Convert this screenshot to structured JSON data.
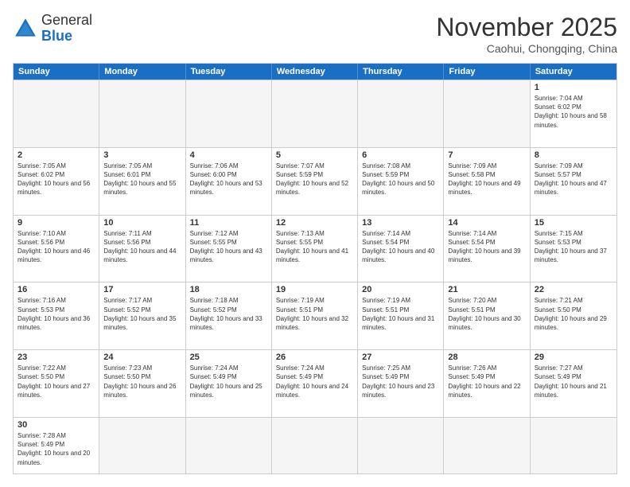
{
  "header": {
    "logo_general": "General",
    "logo_blue": "Blue",
    "month": "November 2025",
    "location": "Caohui, Chongqing, China"
  },
  "weekdays": [
    "Sunday",
    "Monday",
    "Tuesday",
    "Wednesday",
    "Thursday",
    "Friday",
    "Saturday"
  ],
  "weeks": [
    [
      {
        "day": "",
        "info": ""
      },
      {
        "day": "",
        "info": ""
      },
      {
        "day": "",
        "info": ""
      },
      {
        "day": "",
        "info": ""
      },
      {
        "day": "",
        "info": ""
      },
      {
        "day": "",
        "info": ""
      },
      {
        "day": "1",
        "info": "Sunrise: 7:04 AM\nSunset: 6:02 PM\nDaylight: 10 hours and 58 minutes."
      }
    ],
    [
      {
        "day": "2",
        "info": "Sunrise: 7:05 AM\nSunset: 6:02 PM\nDaylight: 10 hours and 56 minutes."
      },
      {
        "day": "3",
        "info": "Sunrise: 7:05 AM\nSunset: 6:01 PM\nDaylight: 10 hours and 55 minutes."
      },
      {
        "day": "4",
        "info": "Sunrise: 7:06 AM\nSunset: 6:00 PM\nDaylight: 10 hours and 53 minutes."
      },
      {
        "day": "5",
        "info": "Sunrise: 7:07 AM\nSunset: 5:59 PM\nDaylight: 10 hours and 52 minutes."
      },
      {
        "day": "6",
        "info": "Sunrise: 7:08 AM\nSunset: 5:59 PM\nDaylight: 10 hours and 50 minutes."
      },
      {
        "day": "7",
        "info": "Sunrise: 7:09 AM\nSunset: 5:58 PM\nDaylight: 10 hours and 49 minutes."
      },
      {
        "day": "8",
        "info": "Sunrise: 7:09 AM\nSunset: 5:57 PM\nDaylight: 10 hours and 47 minutes."
      }
    ],
    [
      {
        "day": "9",
        "info": "Sunrise: 7:10 AM\nSunset: 5:56 PM\nDaylight: 10 hours and 46 minutes."
      },
      {
        "day": "10",
        "info": "Sunrise: 7:11 AM\nSunset: 5:56 PM\nDaylight: 10 hours and 44 minutes."
      },
      {
        "day": "11",
        "info": "Sunrise: 7:12 AM\nSunset: 5:55 PM\nDaylight: 10 hours and 43 minutes."
      },
      {
        "day": "12",
        "info": "Sunrise: 7:13 AM\nSunset: 5:55 PM\nDaylight: 10 hours and 41 minutes."
      },
      {
        "day": "13",
        "info": "Sunrise: 7:14 AM\nSunset: 5:54 PM\nDaylight: 10 hours and 40 minutes."
      },
      {
        "day": "14",
        "info": "Sunrise: 7:14 AM\nSunset: 5:54 PM\nDaylight: 10 hours and 39 minutes."
      },
      {
        "day": "15",
        "info": "Sunrise: 7:15 AM\nSunset: 5:53 PM\nDaylight: 10 hours and 37 minutes."
      }
    ],
    [
      {
        "day": "16",
        "info": "Sunrise: 7:16 AM\nSunset: 5:53 PM\nDaylight: 10 hours and 36 minutes."
      },
      {
        "day": "17",
        "info": "Sunrise: 7:17 AM\nSunset: 5:52 PM\nDaylight: 10 hours and 35 minutes."
      },
      {
        "day": "18",
        "info": "Sunrise: 7:18 AM\nSunset: 5:52 PM\nDaylight: 10 hours and 33 minutes."
      },
      {
        "day": "19",
        "info": "Sunrise: 7:19 AM\nSunset: 5:51 PM\nDaylight: 10 hours and 32 minutes."
      },
      {
        "day": "20",
        "info": "Sunrise: 7:19 AM\nSunset: 5:51 PM\nDaylight: 10 hours and 31 minutes."
      },
      {
        "day": "21",
        "info": "Sunrise: 7:20 AM\nSunset: 5:51 PM\nDaylight: 10 hours and 30 minutes."
      },
      {
        "day": "22",
        "info": "Sunrise: 7:21 AM\nSunset: 5:50 PM\nDaylight: 10 hours and 29 minutes."
      }
    ],
    [
      {
        "day": "23",
        "info": "Sunrise: 7:22 AM\nSunset: 5:50 PM\nDaylight: 10 hours and 27 minutes."
      },
      {
        "day": "24",
        "info": "Sunrise: 7:23 AM\nSunset: 5:50 PM\nDaylight: 10 hours and 26 minutes."
      },
      {
        "day": "25",
        "info": "Sunrise: 7:24 AM\nSunset: 5:49 PM\nDaylight: 10 hours and 25 minutes."
      },
      {
        "day": "26",
        "info": "Sunrise: 7:24 AM\nSunset: 5:49 PM\nDaylight: 10 hours and 24 minutes."
      },
      {
        "day": "27",
        "info": "Sunrise: 7:25 AM\nSunset: 5:49 PM\nDaylight: 10 hours and 23 minutes."
      },
      {
        "day": "28",
        "info": "Sunrise: 7:26 AM\nSunset: 5:49 PM\nDaylight: 10 hours and 22 minutes."
      },
      {
        "day": "29",
        "info": "Sunrise: 7:27 AM\nSunset: 5:49 PM\nDaylight: 10 hours and 21 minutes."
      }
    ],
    [
      {
        "day": "30",
        "info": "Sunrise: 7:28 AM\nSunset: 5:49 PM\nDaylight: 10 hours and 20 minutes."
      },
      {
        "day": "",
        "info": ""
      },
      {
        "day": "",
        "info": ""
      },
      {
        "day": "",
        "info": ""
      },
      {
        "day": "",
        "info": ""
      },
      {
        "day": "",
        "info": ""
      },
      {
        "day": "",
        "info": ""
      }
    ]
  ]
}
